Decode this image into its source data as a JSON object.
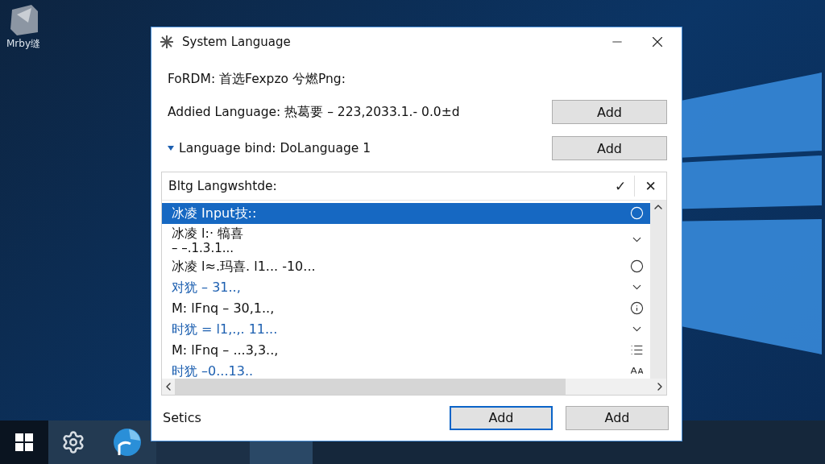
{
  "desktop": {
    "icon_label": "Mrby缝"
  },
  "window": {
    "title": "System Language"
  },
  "form_line": "FoRDM: 首选Fexpzo 兮燃Png:",
  "settings": [
    {
      "label": "Addied Language: 热葛要 – 223,2033.1.- 0.0±d",
      "expandable": false,
      "button": "Add"
    },
    {
      "label": "Language bind: DoLanguage 1",
      "expandable": true,
      "button": "Add"
    }
  ],
  "list": {
    "header": "Bltg Langwshtde:",
    "confirm": "✓",
    "clear": "✕",
    "rows": [
      {
        "text": "冰凌 Input技::",
        "subtext": null,
        "selected": true,
        "accent": false,
        "kind": "circle"
      },
      {
        "text": "冰凌 l:· 犒喜",
        "subtext": "– –.1.3.1...",
        "selected": false,
        "accent": false,
        "kind": "chevron"
      },
      {
        "text": "冰凌 l≈.玛喜. l1... -10...",
        "selected": false,
        "accent": false,
        "kind": "circle"
      },
      {
        "text": "对犹 – 31..,",
        "selected": false,
        "accent": true,
        "kind": "chevron"
      },
      {
        "text": "M: lFnq – 30,1..,",
        "selected": false,
        "accent": false,
        "kind": "info"
      },
      {
        "text": "时犹 = l1,.,. 11...",
        "selected": false,
        "accent": true,
        "kind": "chevron"
      },
      {
        "text": "M: lFnq – ...3,3..,",
        "selected": false,
        "accent": false,
        "kind": "list"
      },
      {
        "text": "时犹 –0...13..",
        "selected": false,
        "accent": true,
        "kind": "font"
      }
    ]
  },
  "footer": {
    "label": "Setics",
    "buttons": [
      {
        "label": "Add",
        "selected": true
      },
      {
        "label": "Add",
        "selected": false
      }
    ]
  }
}
